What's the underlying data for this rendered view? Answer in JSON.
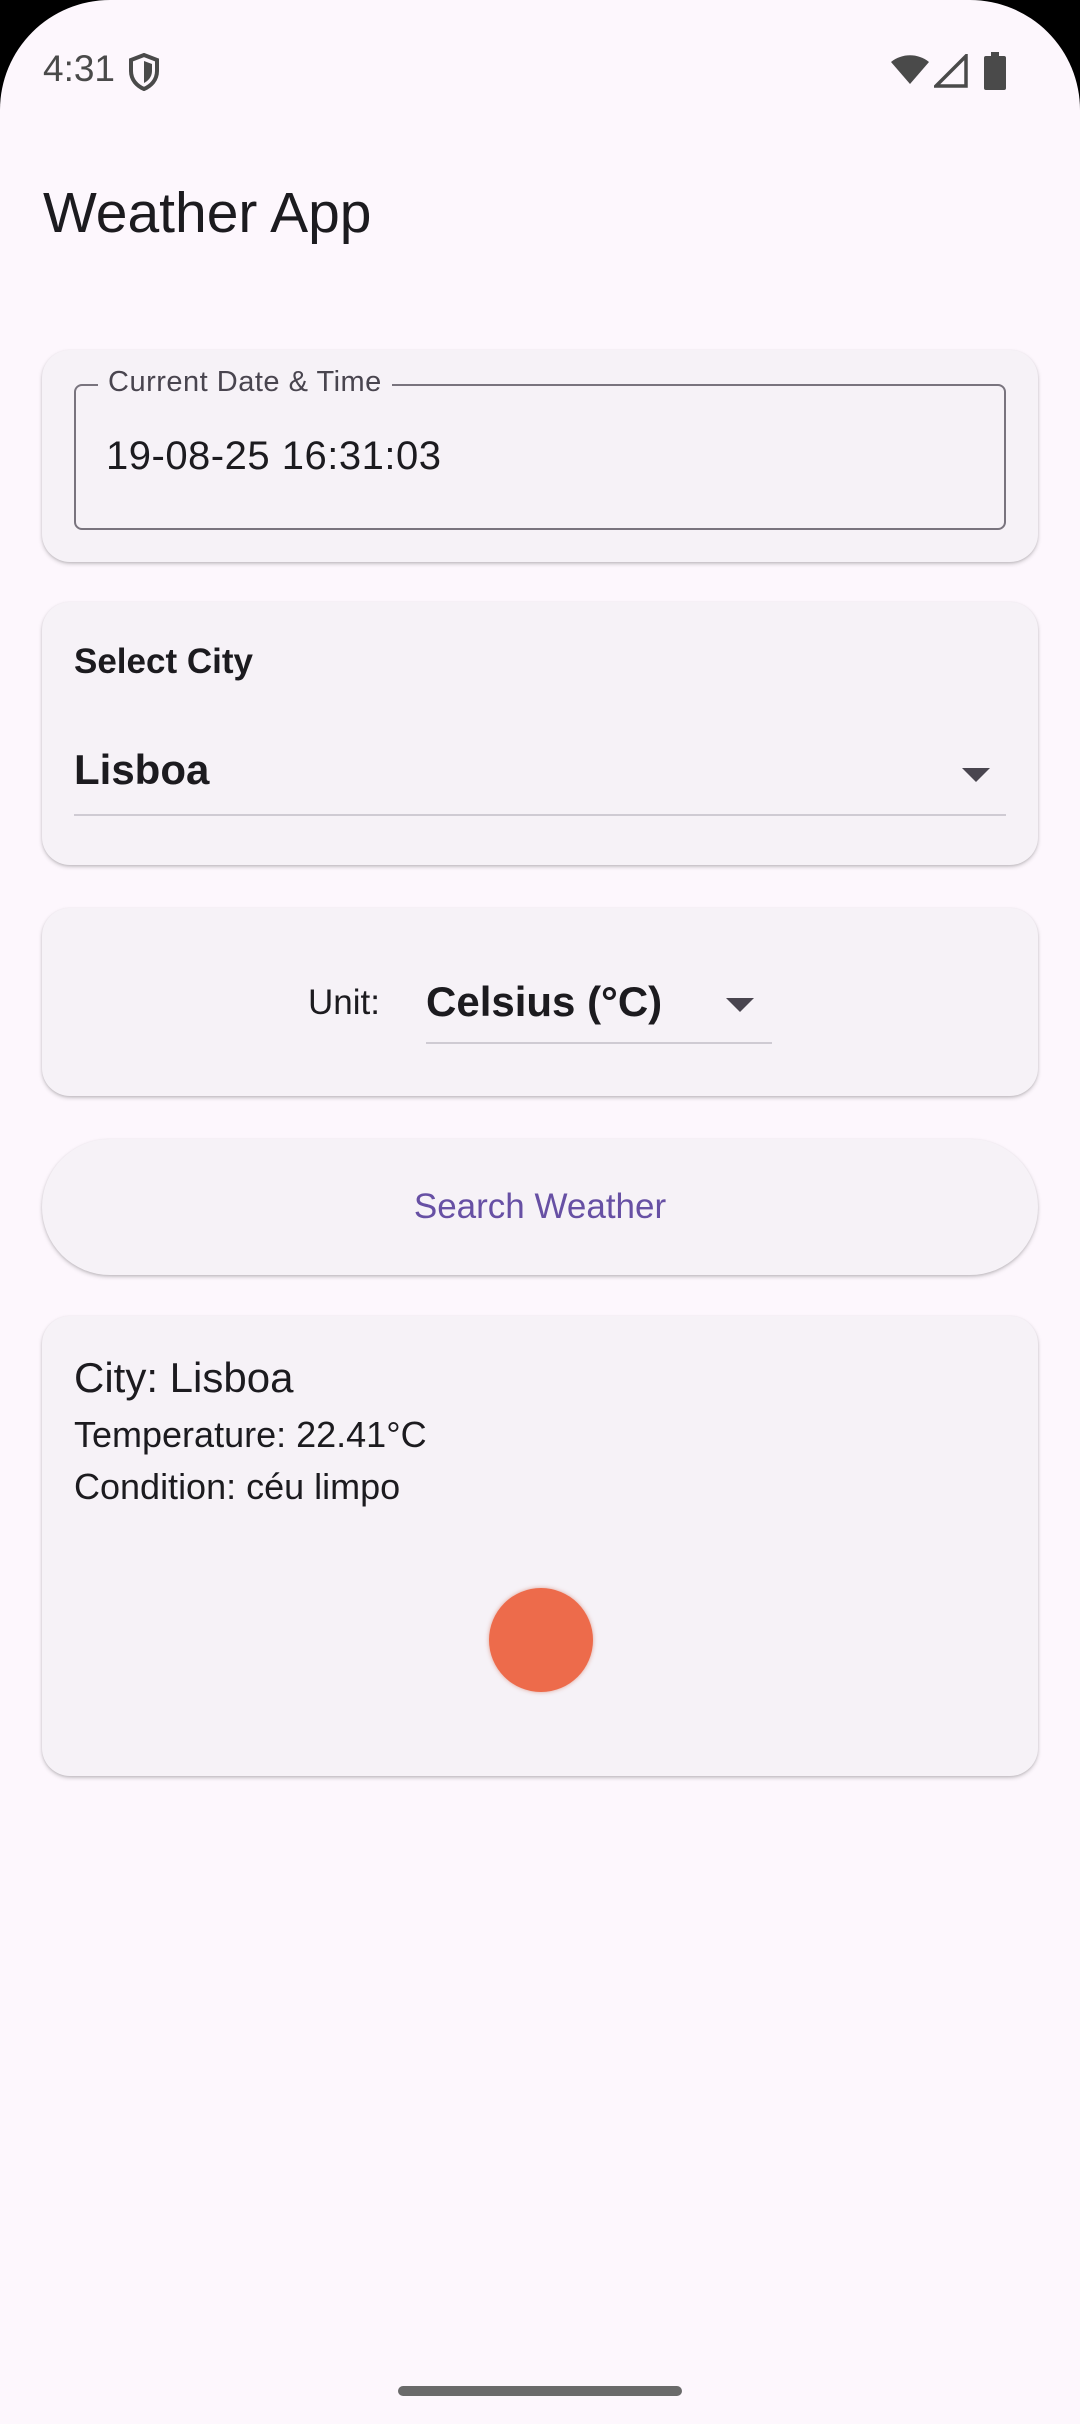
{
  "status_bar": {
    "time": "4:31",
    "icons": [
      "shield-icon",
      "wifi-icon",
      "signal-icon",
      "battery-icon"
    ]
  },
  "app": {
    "title": "Weather App"
  },
  "datetime": {
    "label": "Current Date & Time",
    "value": "19-08-25 16:31:03"
  },
  "city_select": {
    "label": "Select City",
    "selected": "Lisboa"
  },
  "unit_select": {
    "label": "Unit:",
    "selected": "Celsius (°C)"
  },
  "search": {
    "button_label": "Search Weather"
  },
  "result": {
    "city": "City: Lisboa",
    "temperature": "Temperature: 22.41°C",
    "condition": "Condition: céu limpo",
    "icon": "sun-icon",
    "icon_color": "#ed6b4b"
  },
  "colors": {
    "background": "#fdf7fd",
    "card": "#f6f2f7",
    "accent": "#6750a4"
  }
}
